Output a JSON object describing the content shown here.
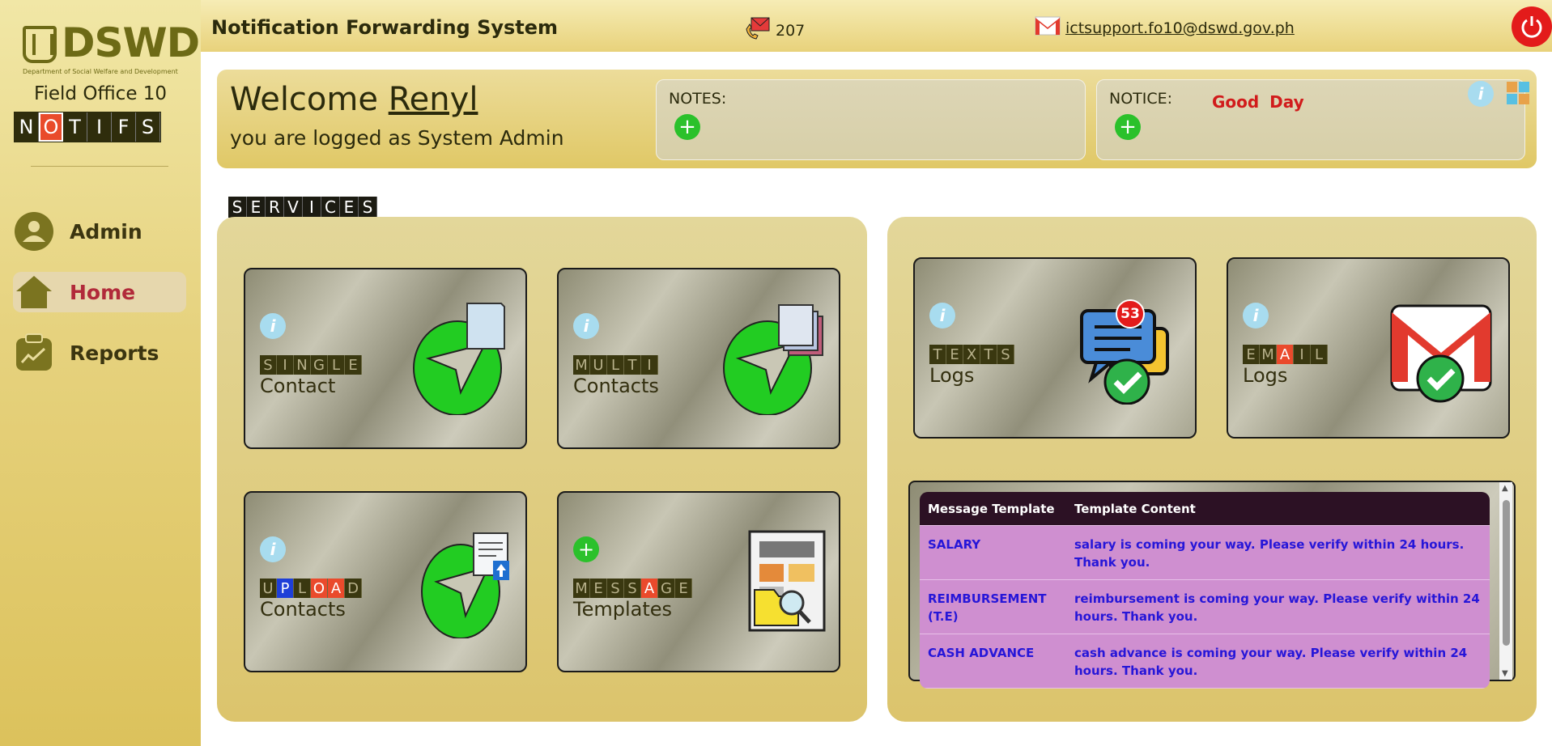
{
  "sidebar": {
    "brand": "DSWD",
    "dept": "Department of Social Welfare and Development",
    "field_office": "Field Office 10",
    "notifs_letters": [
      "N",
      "O",
      "T",
      "I",
      "F",
      "S"
    ],
    "items": [
      {
        "label": "Admin",
        "icon": "user-icon"
      },
      {
        "label": "Home",
        "icon": "home-icon",
        "active": true
      },
      {
        "label": "Reports",
        "icon": "clipboard-icon"
      }
    ]
  },
  "topbar": {
    "title": "Notification Forwarding System",
    "message_count": "207",
    "email": "ictsupport.fo10@dswd.gov.ph"
  },
  "welcome": {
    "greeting": "Welcome",
    "username": "Renyl",
    "role_text": "you are logged as System Admin",
    "notes_label": "NOTES:",
    "notice_label": "NOTICE:",
    "notice_text": "Good Day"
  },
  "services_letters": [
    "S",
    "E",
    "R",
    "V",
    "I",
    "C",
    "E",
    "S"
  ],
  "cards": {
    "single": {
      "tag": [
        "S",
        "I",
        "N",
        "G",
        "L",
        "E"
      ],
      "sub": "Contact"
    },
    "multi": {
      "tag": [
        "M",
        "U",
        "L",
        "T",
        "I"
      ],
      "sub": "Contacts"
    },
    "upload": {
      "tag": [
        "U",
        "P",
        "L",
        "O",
        "A",
        "D"
      ],
      "sub": "Contacts"
    },
    "message": {
      "tag": [
        "M",
        "E",
        "S",
        "S",
        "A",
        "G",
        "E"
      ],
      "sub": "Templates"
    },
    "texts": {
      "tag": [
        "T",
        "E",
        "X",
        "T",
        "S"
      ],
      "sub": "Logs",
      "badge": "53"
    },
    "email": {
      "tag": [
        "E",
        "M",
        "A",
        "I",
        "L"
      ],
      "sub": "Logs"
    }
  },
  "template_table": {
    "headers": [
      "Message Template",
      "Template Content"
    ],
    "rows": [
      {
        "name": "SALARY",
        "content": "salary is coming your way. Please verify within 24 hours. Thank you."
      },
      {
        "name": "REIMBURSEMENT (T.E)",
        "content": "reimbursement is coming your way. Please verify within 24 hours. Thank you."
      },
      {
        "name": "CASH ADVANCE",
        "content": "cash advance is coming your way. Please verify within 24 hours. Thank you."
      }
    ]
  },
  "colors": {
    "accent_red": "#e31b1b",
    "plus_green": "#2bc12b",
    "info_blue": "#a8dcef",
    "table_head": "#2c1124",
    "table_row": "#cf8fd0"
  }
}
